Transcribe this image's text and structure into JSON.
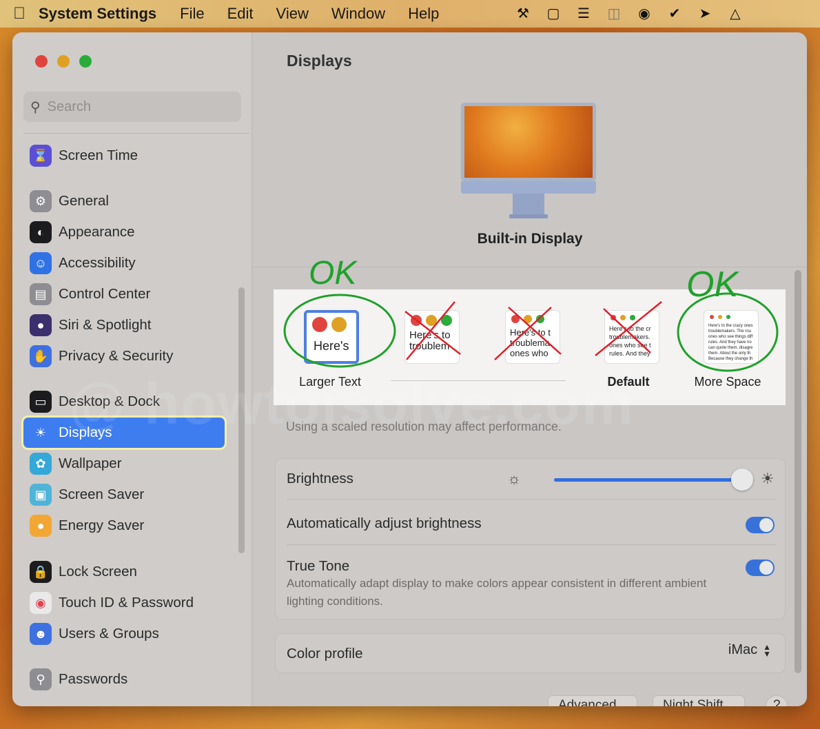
{
  "menubar": {
    "app_name": "System Settings",
    "menus": [
      "File",
      "Edit",
      "View",
      "Window",
      "Help"
    ]
  },
  "sidebar": {
    "search_placeholder": "Search",
    "items": [
      {
        "label": "Screen Time",
        "icon": "hourglass-icon",
        "color": "#5b4fd6"
      },
      {
        "label": "General",
        "icon": "gear-icon",
        "color": "#8d8d92"
      },
      {
        "label": "Appearance",
        "icon": "appearance-icon",
        "color": "#1c1c1e"
      },
      {
        "label": "Accessibility",
        "icon": "accessibility-icon",
        "color": "#2f72e4"
      },
      {
        "label": "Control Center",
        "icon": "control-center-icon",
        "color": "#8d8d92"
      },
      {
        "label": "Siri & Spotlight",
        "icon": "siri-icon",
        "color": "#3b2f6e"
      },
      {
        "label": "Privacy & Security",
        "icon": "hand-icon",
        "color": "#3f70e0"
      },
      {
        "label": "Desktop & Dock",
        "icon": "dock-icon",
        "color": "#1c1c1e"
      },
      {
        "label": "Displays",
        "icon": "sun-icon",
        "color": "#3d7df0"
      },
      {
        "label": "Wallpaper",
        "icon": "flower-icon",
        "color": "#34a8d6"
      },
      {
        "label": "Screen Saver",
        "icon": "screen-saver-icon",
        "color": "#4fb4d8"
      },
      {
        "label": "Energy Saver",
        "icon": "lightbulb-icon",
        "color": "#f2a735"
      },
      {
        "label": "Lock Screen",
        "icon": "lock-icon",
        "color": "#1c1c1e"
      },
      {
        "label": "Touch ID & Password",
        "icon": "fingerprint-icon",
        "color": "#e9e9e9"
      },
      {
        "label": "Users & Groups",
        "icon": "users-icon",
        "color": "#3f70e0"
      },
      {
        "label": "Passwords",
        "icon": "key-icon",
        "color": "#8d8d92"
      }
    ],
    "active": "Displays"
  },
  "main": {
    "title": "Displays",
    "display_name": "Built-in Display",
    "resolution_options": [
      {
        "label": "Larger Text",
        "preview": "Here's",
        "selected": true
      },
      {
        "label": "",
        "preview": "Here's to troublem",
        "selected": false
      },
      {
        "label": "",
        "preview": "Here's to t troublema ones who",
        "selected": false
      },
      {
        "label": "Default",
        "preview": "Here's to the cr troublemakers. ones who see t rules. And they",
        "selected": false
      },
      {
        "label": "More Space",
        "preview": "Here's to the crazy ones troublemakers. The rou ones who see things diff rules. And they have no can quote them, disagre them. About the only th Because they change th",
        "selected": false
      }
    ],
    "perf_note": "Using a scaled resolution may affect performance.",
    "brightness_label": "Brightness",
    "brightness_level": 0.94,
    "auto_brightness_label": "Automatically adjust brightness",
    "auto_brightness_on": true,
    "true_tone_label": "True Tone",
    "true_tone_desc": "Automatically adapt display to make colors appear consistent in different ambient lighting conditions.",
    "true_tone_on": true,
    "color_profile_label": "Color profile",
    "color_profile_value": "iMac",
    "buttons": {
      "advanced": "Advanced...",
      "night_shift": "Night Shift...",
      "help": "?"
    }
  },
  "annotations": {
    "ok_left": "OK",
    "ok_right": "OK",
    "colors": {
      "circle": "#1fa12a",
      "cross": "#e0202a"
    }
  },
  "watermark": "@ howtoisolve.com"
}
